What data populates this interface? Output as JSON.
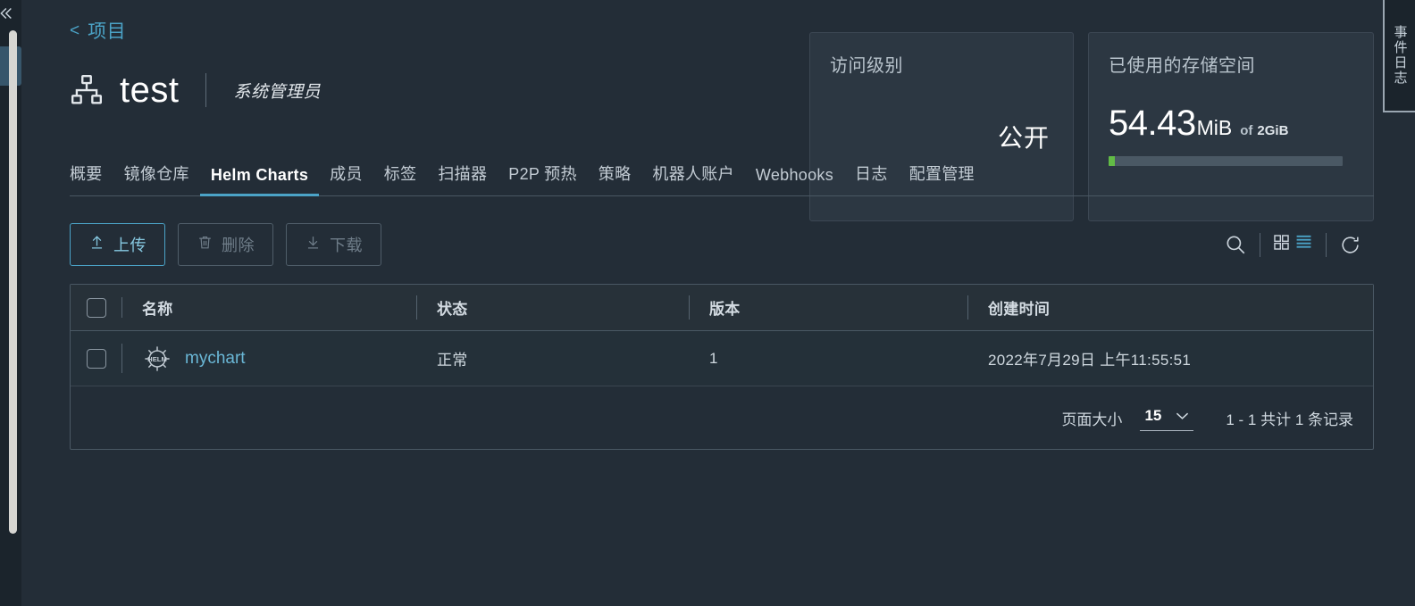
{
  "breadcrumb": {
    "back_icon": "chevron-left-icon",
    "label": "项目"
  },
  "project": {
    "icon": "project-sitemap-icon",
    "name": "test",
    "role": "系统管理员"
  },
  "cards": {
    "access": {
      "title": "访问级别",
      "value": "公开"
    },
    "storage": {
      "title": "已使用的存储空间",
      "used_number": "54.43",
      "used_unit": "MiB",
      "of_label": "of",
      "total": "2GiB",
      "progress_percent": 2.6,
      "progress_color": "#62bb46"
    }
  },
  "tabs": [
    {
      "label": "概要",
      "active": false
    },
    {
      "label": "镜像仓库",
      "active": false
    },
    {
      "label": "Helm Charts",
      "active": true
    },
    {
      "label": "成员",
      "active": false
    },
    {
      "label": "标签",
      "active": false
    },
    {
      "label": "扫描器",
      "active": false
    },
    {
      "label": "P2P 预热",
      "active": false
    },
    {
      "label": "策略",
      "active": false
    },
    {
      "label": "机器人账户",
      "active": false
    },
    {
      "label": "Webhooks",
      "active": false
    },
    {
      "label": "日志",
      "active": false
    },
    {
      "label": "配置管理",
      "active": false
    }
  ],
  "toolbar": {
    "upload_label": "上传",
    "upload_icon": "upload-arrow-icon",
    "delete_label": "删除",
    "delete_icon": "trash-icon",
    "download_label": "下载",
    "download_icon": "download-arrow-icon",
    "search_icon": "search-icon",
    "grid_view_icon": "grid-view-icon",
    "list_view_icon": "list-view-icon",
    "refresh_icon": "refresh-icon"
  },
  "table": {
    "columns": [
      "名称",
      "状态",
      "版本",
      "创建时间"
    ],
    "rows": [
      {
        "icon": "helm-chart-icon",
        "name": "mychart",
        "status": "正常",
        "version": "1",
        "created": "2022年7月29日 上午11:55:51"
      }
    ]
  },
  "pagination": {
    "page_size_label": "页面大小",
    "page_size_value": "15",
    "caret_icon": "chevron-down-icon",
    "range_text": "1 - 1 共计 1 条记录"
  },
  "right_rail": {
    "label": "事件日志"
  },
  "colors": {
    "accent": "#4ba3c7",
    "background": "#232d37",
    "card": "#2c3742",
    "link": "#6ab7d6"
  }
}
